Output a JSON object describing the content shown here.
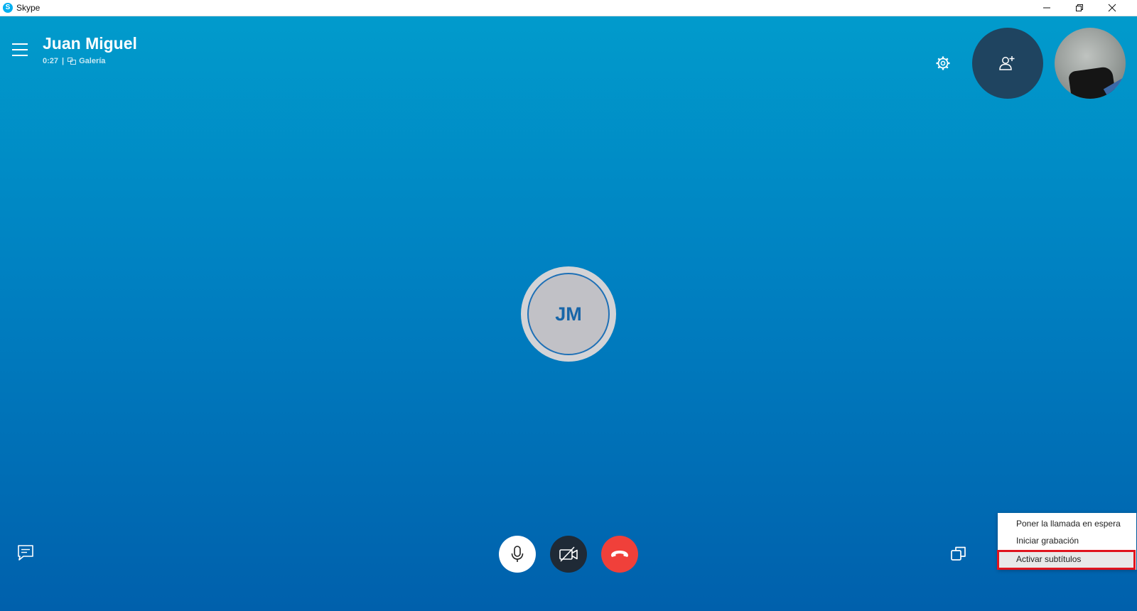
{
  "window": {
    "app_title": "Skype",
    "logo_glyph": "S",
    "controls": [
      "minimize-icon",
      "restore-icon",
      "close-icon"
    ]
  },
  "header": {
    "contact_name": "Juan Miguel",
    "duration": "0:27",
    "separator": "|",
    "view_mode": "Galería"
  },
  "participant": {
    "initials": "JM"
  },
  "controls": {
    "icons": [
      "chat-icon",
      "microphone-icon",
      "video-off-icon",
      "hang-up-icon",
      "switch-view-icon",
      "snapshot-icon",
      "heart-icon",
      "plus-icon"
    ]
  },
  "more_menu": {
    "items": [
      "Poner la llamada en espera",
      "Iniciar grabación",
      "Activar subtítulos"
    ]
  },
  "colors": {
    "call_background_top": "#019bcc",
    "call_background_bottom": "#0060ac",
    "hangup_red": "#f0403a",
    "highlight_red": "#e0141e",
    "avatar_text": "#1765a8"
  }
}
